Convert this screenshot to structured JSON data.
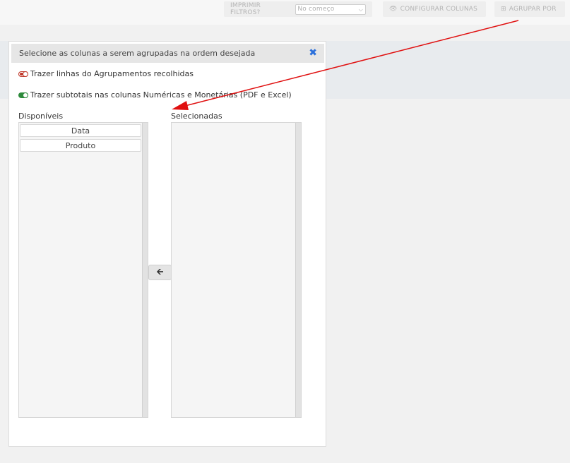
{
  "toolbar": {
    "print_filters_label": "IMPRIMIR FILTROS?",
    "print_filters_value": "No começo",
    "config_columns_label": "CONFIGURAR COLUNAS",
    "group_by_label": "AGRUPAR POR",
    "icons": {
      "config": "eye-icon",
      "group": "plus-square-icon"
    }
  },
  "modal": {
    "title": "Selecione as colunas a serem agrupadas na ordem desejada",
    "close_icon": "close-icon",
    "options": [
      {
        "label": "Trazer linhas do Agrupamentos recolhidas",
        "on": false
      },
      {
        "label": "Trazer subtotais nas colunas Numéricas e Monetárias (PDF e Excel)",
        "on": true
      }
    ],
    "available": {
      "title": "Disponíveis",
      "items": [
        "Data",
        "Produto"
      ]
    },
    "selected": {
      "title": "Selecionadas",
      "items": []
    },
    "move_button_icon": "arrow-left-icon"
  },
  "colors": {
    "toggle_off": "#c0392b",
    "toggle_on": "#2e8b3c",
    "close": "#2a6fdb",
    "annotation_arrow": "#e01010"
  }
}
